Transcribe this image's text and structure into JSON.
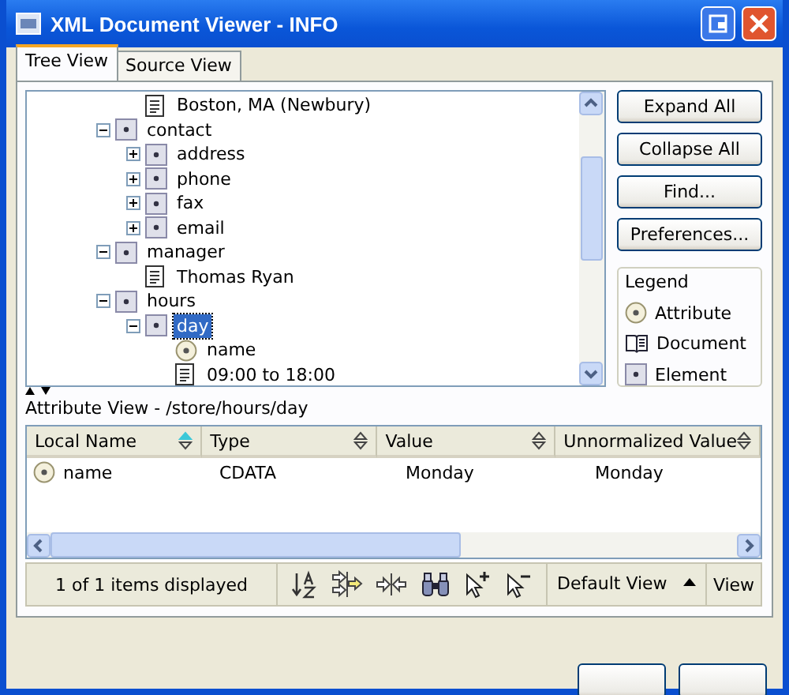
{
  "window": {
    "title": "XML Document Viewer - INFO"
  },
  "tabs": [
    {
      "label": "Tree View",
      "selected": true
    },
    {
      "label": "Source View",
      "selected": false
    }
  ],
  "tree": {
    "clipped_children": [
      {
        "kind": "text",
        "label": "Boston, MA (Newbury)",
        "selected": false
      }
    ],
    "nodes": [
      {
        "kind": "element",
        "label": "contact",
        "expanded": true,
        "selected": false,
        "children": [
          {
            "kind": "element",
            "label": "address",
            "expanded": false,
            "selected": false
          },
          {
            "kind": "element",
            "label": "phone",
            "expanded": false,
            "selected": false
          },
          {
            "kind": "element",
            "label": "fax",
            "expanded": false,
            "selected": false
          },
          {
            "kind": "element",
            "label": "email",
            "expanded": false,
            "selected": false
          }
        ]
      },
      {
        "kind": "element",
        "label": "manager",
        "expanded": true,
        "selected": false,
        "children": [
          {
            "kind": "text",
            "label": "Thomas Ryan",
            "selected": false
          }
        ]
      },
      {
        "kind": "element",
        "label": "hours",
        "expanded": true,
        "selected": false,
        "children": [
          {
            "kind": "element",
            "label": "day",
            "expanded": true,
            "selected": true,
            "children": [
              {
                "kind": "attribute",
                "label": "name",
                "selected": false
              },
              {
                "kind": "text",
                "label": "09:00 to 18:00",
                "selected": false
              }
            ]
          }
        ]
      }
    ]
  },
  "actions": [
    "Expand All",
    "Collapse All",
    "Find...",
    "Preferences..."
  ],
  "legend": {
    "title": "Legend",
    "items": [
      {
        "kind": "attribute",
        "label": "Attribute"
      },
      {
        "kind": "document",
        "label": "Document"
      },
      {
        "kind": "element",
        "label": "Element"
      }
    ]
  },
  "attribute_view": {
    "title": "Attribute View - /store/hours/day",
    "columns": [
      {
        "label": "Local Name",
        "sorted": true
      },
      {
        "label": "Type",
        "sorted": false
      },
      {
        "label": "Value",
        "sorted": false
      },
      {
        "label": "Unnormalized Value",
        "sorted": false
      }
    ],
    "rows": [
      {
        "kind": "attribute",
        "cells": [
          "name",
          "CDATA",
          "Monday",
          "Monday"
        ]
      }
    ]
  },
  "status": {
    "count": "1 of 1 items displayed",
    "view_select": "Default View",
    "view_button": "View"
  }
}
